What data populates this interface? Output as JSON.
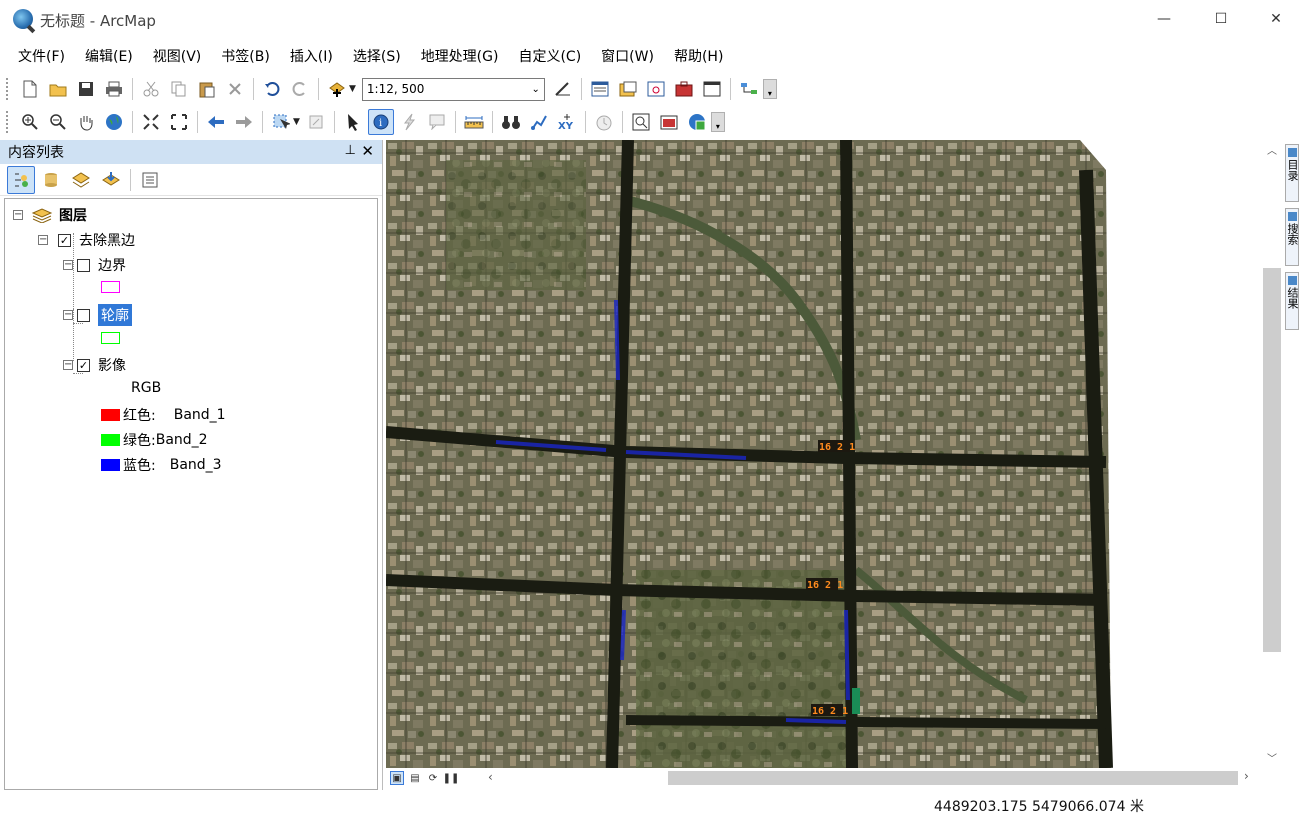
{
  "window": {
    "title": "无标题 - ArcMap",
    "minimize": "—",
    "maximize": "☐",
    "close": "✕"
  },
  "menu": [
    "文件(F)",
    "编辑(E)",
    "视图(V)",
    "书签(B)",
    "插入(I)",
    "选择(S)",
    "地理处理(G)",
    "自定义(C)",
    "窗口(W)",
    "帮助(H)"
  ],
  "toolbar": {
    "scale_value": "1:12, 500"
  },
  "toc": {
    "title": "内容列表",
    "pin": "⊥",
    "close": "✕",
    "root_label": "图层",
    "group_label": "去除黑边",
    "layers": {
      "boundary": "边界",
      "outline": "轮廓",
      "image": "影像"
    },
    "rgb_label": "RGB",
    "bands": [
      {
        "name": "红色:",
        "band": "Band_1",
        "color": "#ff0000"
      },
      {
        "name": "绿色:",
        "band": "Band_2",
        "color": "#00ff00"
      },
      {
        "name": "蓝色:",
        "band": "Band_3",
        "color": "#0000ff"
      }
    ],
    "boundary_color": "#ff00ff",
    "outline_color": "#00ff00"
  },
  "right_dock": {
    "tabs": [
      "目录",
      "搜索",
      "结果"
    ]
  },
  "status": {
    "coordinates": "4489203.175  5479066.074 米"
  },
  "map": {
    "labels": [
      "16 2 1",
      "16 2 1",
      "16 2 1"
    ]
  }
}
